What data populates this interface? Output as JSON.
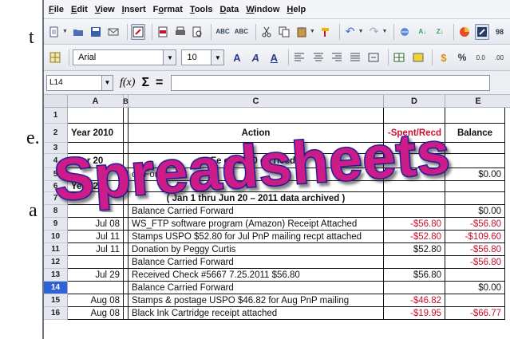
{
  "background_text": [
    "t",
    "e.",
    "a"
  ],
  "menu": [
    "File",
    "Edit",
    "View",
    "Insert",
    "Format",
    "Tools",
    "Data",
    "Window",
    "Help"
  ],
  "menu_mnemonic": [
    "F",
    "E",
    "V",
    "I",
    "o",
    "T",
    "D",
    "W",
    "H"
  ],
  "format_bar": {
    "font": "Arial",
    "size": "10"
  },
  "formula_bar": {
    "cell_ref": "L14",
    "fx": "f(x)",
    "sigma": "Σ",
    "equals": "="
  },
  "columns": [
    "A",
    "B",
    "C",
    "D",
    "E"
  ],
  "rows": [
    {
      "n": "1",
      "a": "",
      "c": "",
      "d": "",
      "e": ""
    },
    {
      "n": "2",
      "a": "Year 2010",
      "c": "Action",
      "d": "-Spent/Recd",
      "e": "Balance"
    },
    {
      "n": "3",
      "a": "",
      "c": "",
      "d": "",
      "e": ""
    },
    {
      "n": "4",
      "a": "Year 20",
      "c": "Fe           ed 2010 da      rived )",
      "d": "",
      "e": ""
    },
    {
      "n": "5",
      "a": "",
      "c": "       ce     Forward",
      "d": "",
      "e": "$0.00"
    },
    {
      "n": "6",
      "a": "Year 201",
      "c": "",
      "d": "",
      "e": ""
    },
    {
      "n": "7",
      "a": "",
      "c": "( Jan 1 thru Jun 20 – 2011 data archived )",
      "d": "",
      "e": ""
    },
    {
      "n": "8",
      "a": "",
      "c": "Balance Carried Forward",
      "d": "",
      "e": "$0.00"
    },
    {
      "n": "9",
      "a": "Jul 08",
      "c": "WS_FTP software program (Amazon) Receipt Attached",
      "d": "-$56.80",
      "e": "-$56.80"
    },
    {
      "n": "10",
      "a": "Jul 11",
      "c": "Stamps USPO $52.80 for Jul PnP mailing recpt attached",
      "d": "-$52.80",
      "e": "-$109.60"
    },
    {
      "n": "11",
      "a": "Jul 11",
      "c": "Donation by Peggy Curtis",
      "d": "$52.80",
      "e": "-$56.80"
    },
    {
      "n": "12",
      "a": "",
      "c": "Balance Carried Forward",
      "d": "",
      "e": "-$56.80"
    },
    {
      "n": "13",
      "a": "Jul 29",
      "c": "Received Check #5667 7.25.2011 $56.80",
      "d": "$56.80",
      "e": ""
    },
    {
      "n": "14",
      "a": "",
      "c": "Balance Carried Forward",
      "d": "",
      "e": "$0.00"
    },
    {
      "n": "15",
      "a": "Aug 08",
      "c": "Stamps & postage USPO $46.82 for Aug PnP mailing",
      "d": "-$46.82",
      "e": ""
    },
    {
      "n": "16",
      "a": "Aug 08",
      "c": "Black Ink Cartridge  receipt attached",
      "d": "-$19.95",
      "e": "-$66.77"
    }
  ],
  "overlay_word": "Spreadsheets",
  "colors": {
    "overlay_fill": "#cc1f8a",
    "overlay_stroke": "#1f1a8f",
    "negative": "#c8102e",
    "selected_row": "#2f62d6"
  }
}
